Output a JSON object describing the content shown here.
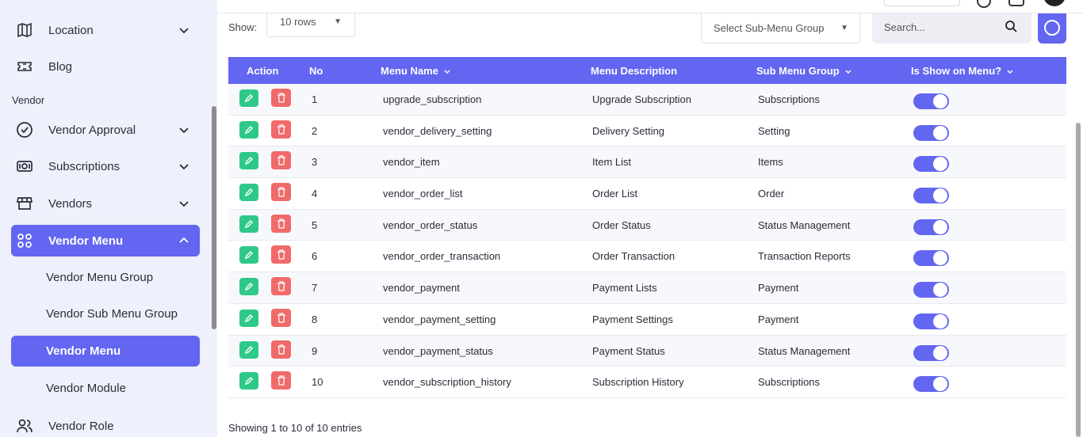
{
  "sidebar": {
    "items_top": [
      {
        "label": "Location",
        "icon": "map-icon"
      },
      {
        "label": "Blog",
        "icon": "ticket-icon"
      }
    ],
    "section_label": "Vendor",
    "vendor_items": [
      {
        "label": "Vendor Approval",
        "icon": "check-circle-icon"
      },
      {
        "label": "Subscriptions",
        "icon": "money-icon"
      },
      {
        "label": "Vendors",
        "icon": "store-icon"
      },
      {
        "label": "Vendor Menu",
        "icon": "grid-icon"
      }
    ],
    "sub_items": [
      {
        "label": "Vendor Menu Group"
      },
      {
        "label": "Vendor Sub Menu Group"
      },
      {
        "label": "Vendor Menu"
      },
      {
        "label": "Vendor Module"
      }
    ],
    "bottom_item": {
      "label": "Vendor Role",
      "icon": "users-icon"
    }
  },
  "controls": {
    "show_label": "Show:",
    "rows_value": "10 rows",
    "group_placeholder": "Select Sub-Menu Group",
    "search_placeholder": "Search..."
  },
  "table": {
    "headers": {
      "action": "Action",
      "no": "No",
      "menu_name": "Menu Name",
      "menu_description": "Menu Description",
      "sub_menu_group": "Sub Menu Group",
      "is_show": "Is Show on Menu?"
    },
    "rows": [
      {
        "no": "1",
        "name": "upgrade_subscription",
        "description": "Upgrade Subscription",
        "group": "Subscriptions",
        "show": true
      },
      {
        "no": "2",
        "name": "vendor_delivery_setting",
        "description": "Delivery Setting",
        "group": "Setting",
        "show": true
      },
      {
        "no": "3",
        "name": "vendor_item",
        "description": "Item List",
        "group": "Items",
        "show": true
      },
      {
        "no": "4",
        "name": "vendor_order_list",
        "description": "Order List",
        "group": "Order",
        "show": true
      },
      {
        "no": "5",
        "name": "vendor_order_status",
        "description": "Order Status",
        "group": "Status Management",
        "show": true
      },
      {
        "no": "6",
        "name": "vendor_order_transaction",
        "description": "Order Transaction",
        "group": "Transaction Reports",
        "show": true
      },
      {
        "no": "7",
        "name": "vendor_payment",
        "description": "Payment Lists",
        "group": "Payment",
        "show": true
      },
      {
        "no": "8",
        "name": "vendor_payment_setting",
        "description": "Payment Settings",
        "group": "Payment",
        "show": true
      },
      {
        "no": "9",
        "name": "vendor_payment_status",
        "description": "Payment Status",
        "group": "Status Management",
        "show": true
      },
      {
        "no": "10",
        "name": "vendor_subscription_history",
        "description": "Subscription History",
        "group": "Subscriptions",
        "show": true
      }
    ]
  },
  "footer": {
    "info": "Showing 1 to 10 of 10 entries"
  },
  "colors": {
    "accent": "#6366f1",
    "edit": "#2ec98a",
    "delete": "#f06a6a"
  }
}
